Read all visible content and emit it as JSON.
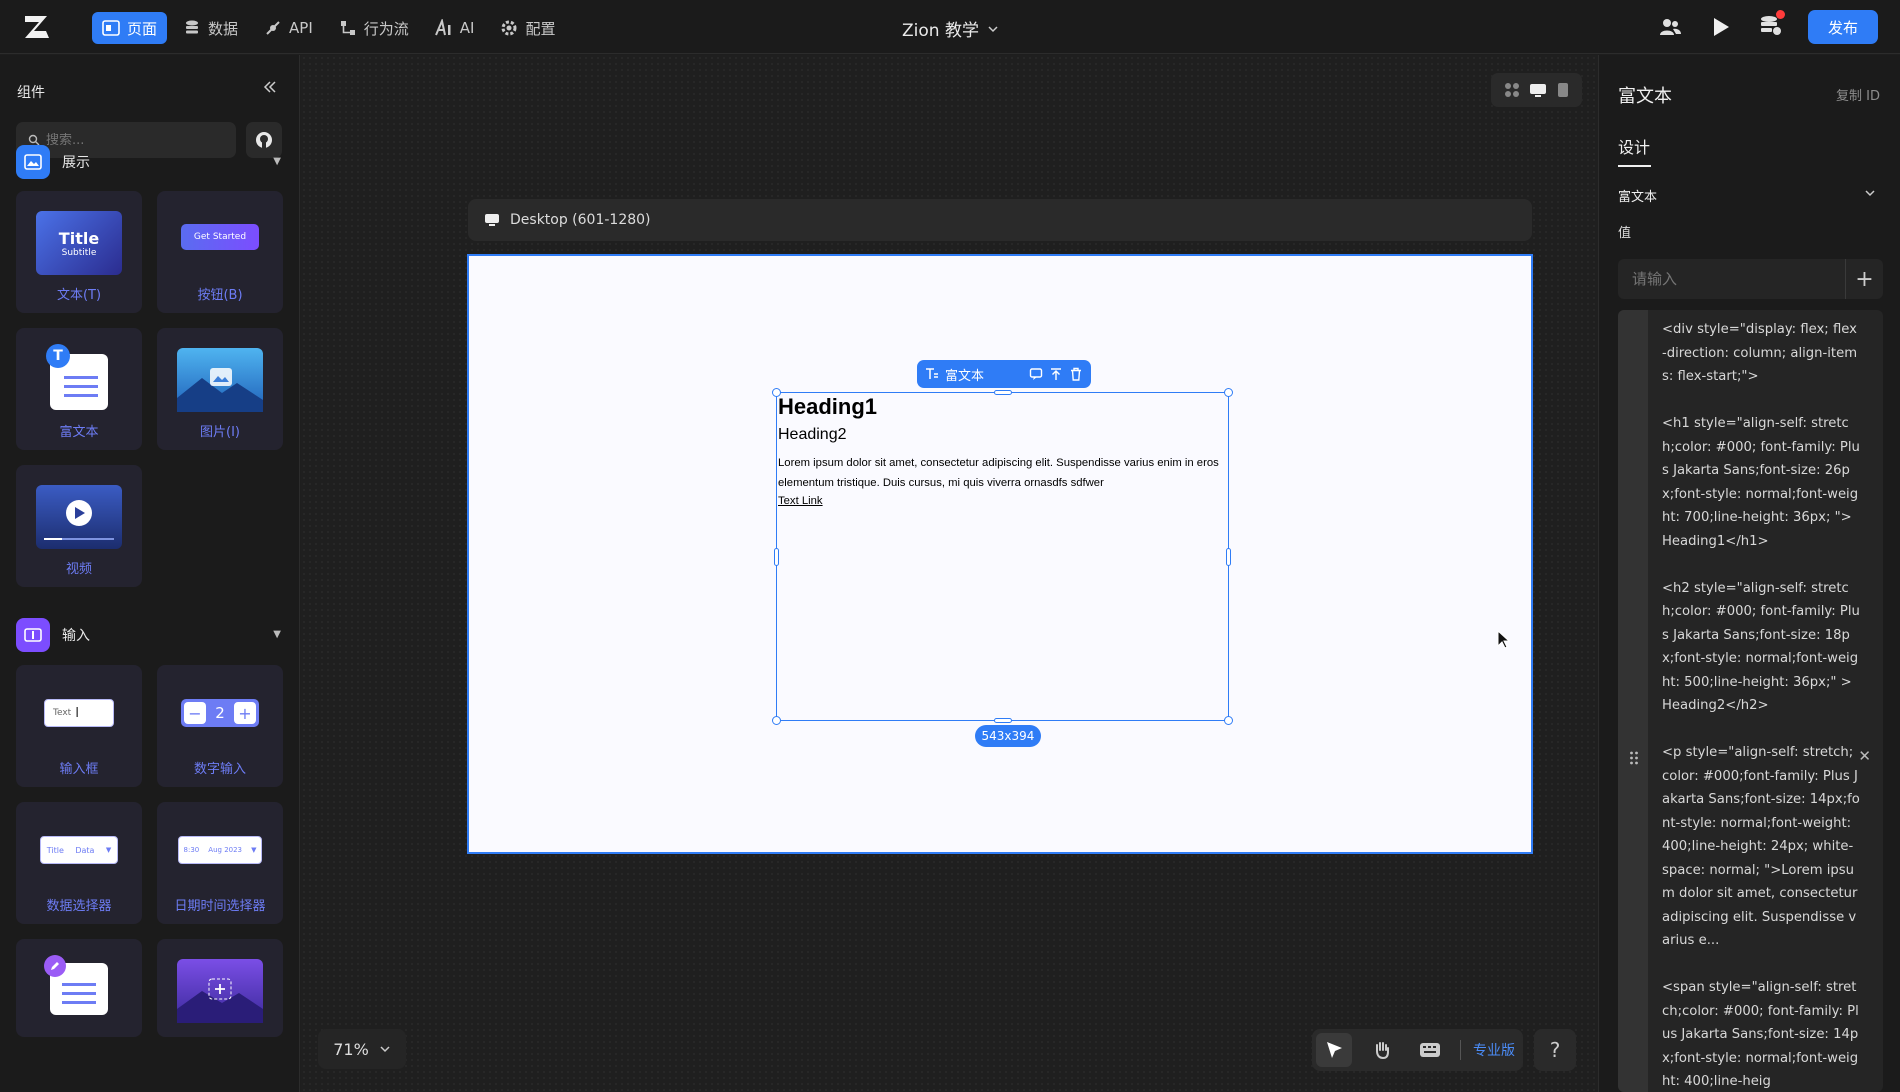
{
  "topbar": {
    "nav": [
      {
        "label": "页面",
        "icon": "page-icon",
        "active": true
      },
      {
        "label": "数据",
        "icon": "database-icon"
      },
      {
        "label": "API",
        "icon": "api-icon"
      },
      {
        "label": "行为流",
        "icon": "flow-icon"
      },
      {
        "label": "AI",
        "icon": "ai-icon"
      },
      {
        "label": "配置",
        "icon": "gear-icon"
      }
    ],
    "app_title": "Zion 教学",
    "publish_label": "发布",
    "accent": "#2f7cf6"
  },
  "left": {
    "title": "组件",
    "search_placeholder": "搜索...",
    "sections": [
      {
        "label": "展示",
        "color": "#2f7cf6",
        "items": [
          {
            "label": "文本(T)",
            "thumb_title": "Title",
            "thumb_sub": "Subtitle"
          },
          {
            "label": "按钮(B)",
            "thumb_text": "Get Started"
          },
          {
            "label": "富文本",
            "thumb_badge": "T"
          },
          {
            "label": "图片(I)"
          },
          {
            "label": "视频"
          }
        ]
      },
      {
        "label": "输入",
        "color": "#7c4dff",
        "items": [
          {
            "label": "输入框",
            "thumb_text": "Text"
          },
          {
            "label": "数字输入",
            "thumb_value": "2"
          },
          {
            "label": "数据选择器",
            "thumb_a": "Title",
            "thumb_b": "Data"
          },
          {
            "label": "日期时间选择器",
            "thumb_a": "8:30",
            "thumb_b": "Aug 2023"
          }
        ]
      }
    ]
  },
  "canvas": {
    "frame_label": "Desktop (601-1280)",
    "selection_label": "富文本",
    "size_badge": "543x394",
    "zoom": "71%",
    "pro_label": "专业版",
    "help": "?",
    "rich_text": {
      "h1": "Heading1",
      "h2": "Heading2",
      "p": "Lorem ipsum dolor sit amet, consectetur adipiscing elit. Suspendisse varius enim in eros elementum tristique. Duis cursus, mi quis viverra ornasdfs sdfwer",
      "link": "Text Link"
    }
  },
  "right": {
    "title": "富文本",
    "copy_id": "复制 ID",
    "tab": "设计",
    "section": "富文本",
    "value_label": "值",
    "input_placeholder": "请输入",
    "code": "<div style=\"display: flex; flex-direction: column; align-items: flex-start;\">\n\n<h1 style=\"align-self: stretch;color: #000; font-family: Plus Jakarta Sans;font-size: 26px;font-style: normal;font-weight: 700;line-height: 36px; \">Heading1</h1>\n\n<h2 style=\"align-self: stretch;color: #000; font-family: Plus Jakarta Sans;font-size: 18px;font-style: normal;font-weight: 500;line-height: 36px;\" >Heading2</h2>\n\n<p style=\"align-self: stretch;color: #000;font-family: Plus Jakarta Sans;font-size: 14px;font-style: normal;font-weight: 400;line-height: 24px; white-space: normal; \">Lorem ipsum dolor sit amet, consectetur adipiscing elit. Suspendisse varius e...\n\n<span style=\"align-self: stretch;color: #000; font-family: Plus Jakarta Sans;font-size: 14px;font-style: normal;font-weight: 400;line-heig"
  }
}
